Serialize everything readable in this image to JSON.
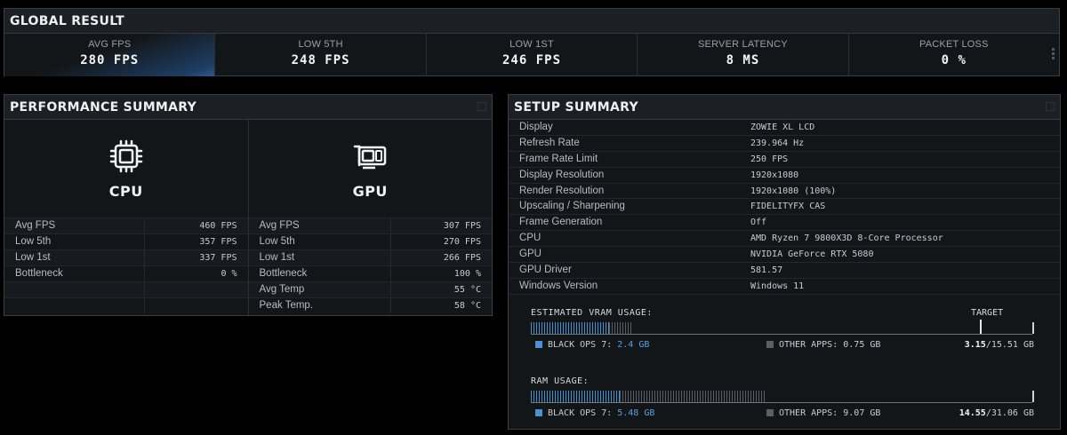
{
  "global": {
    "title": "GLOBAL RESULT",
    "stats": [
      {
        "label": "AVG FPS",
        "value": "280 FPS"
      },
      {
        "label": "LOW 5TH",
        "value": "248 FPS"
      },
      {
        "label": "LOW 1ST",
        "value": "246 FPS"
      },
      {
        "label": "SERVER LATENCY",
        "value": "8 MS"
      },
      {
        "label": "PACKET LOSS",
        "value": "0 %"
      }
    ]
  },
  "performance": {
    "title": "PERFORMANCE SUMMARY",
    "cpu": {
      "name": "CPU",
      "icon": "cpu-icon",
      "rows": [
        {
          "k": "Avg FPS",
          "v": "460 FPS"
        },
        {
          "k": "Low 5th",
          "v": "357 FPS"
        },
        {
          "k": "Low 1st",
          "v": "337 FPS"
        },
        {
          "k": "Bottleneck",
          "v": "0 %"
        },
        {
          "k": "",
          "v": ""
        },
        {
          "k": "",
          "v": ""
        }
      ]
    },
    "gpu": {
      "name": "GPU",
      "icon": "gpu-icon",
      "rows": [
        {
          "k": "Avg FPS",
          "v": "307 FPS"
        },
        {
          "k": "Low 5th",
          "v": "270 FPS"
        },
        {
          "k": "Low 1st",
          "v": "266 FPS"
        },
        {
          "k": "Bottleneck",
          "v": "100 %"
        },
        {
          "k": "Avg Temp",
          "v": "55 °C"
        },
        {
          "k": "Peak Temp.",
          "v": "58 °C"
        }
      ]
    }
  },
  "setup": {
    "title": "SETUP SUMMARY",
    "rows": [
      {
        "k": "Display",
        "v": "ZOWIE XL LCD"
      },
      {
        "k": "Refresh Rate",
        "v": "239.964 Hz"
      },
      {
        "k": "Frame Rate Limit",
        "v": "250 FPS"
      },
      {
        "k": "Display Resolution",
        "v": "1920x1080"
      },
      {
        "k": "Render Resolution",
        "v": "1920x1080 (100%)"
      },
      {
        "k": "Upscaling / Sharpening",
        "v": "FIDELITYFX CAS"
      },
      {
        "k": "Frame Generation",
        "v": "Off"
      },
      {
        "k": "CPU",
        "v": "AMD Ryzen 7 9800X3D 8-Core Processor"
      },
      {
        "k": "GPU",
        "v": "NVIDIA GeForce RTX 5080"
      },
      {
        "k": "GPU Driver",
        "v": "581.57"
      },
      {
        "k": "Windows Version",
        "v": "Windows 11"
      }
    ],
    "vram": {
      "title": "ESTIMATED VRAM USAGE:",
      "target_label": "TARGET",
      "game_label": "BLACK OPS 7:",
      "game_value": "2.4 GB",
      "other_label": "OTHER APPS:",
      "other_value": "0.75 GB",
      "used": "3.15",
      "total": "/15.51 GB",
      "game_fraction": 0.155,
      "other_fraction": 0.048,
      "target_fraction": 0.893
    },
    "ram": {
      "title": "RAM USAGE:",
      "game_label": "BLACK OPS 7:",
      "game_value": "5.48 GB",
      "other_label": "OTHER APPS:",
      "other_value": "9.07 GB",
      "used": "14.55",
      "total": "/31.06 GB",
      "game_fraction": 0.176,
      "other_fraction": 0.292
    }
  },
  "colors": {
    "accent_blue": "#4e8fd0",
    "other_gray": "#5b5f64",
    "panel_bg": "#131619"
  }
}
